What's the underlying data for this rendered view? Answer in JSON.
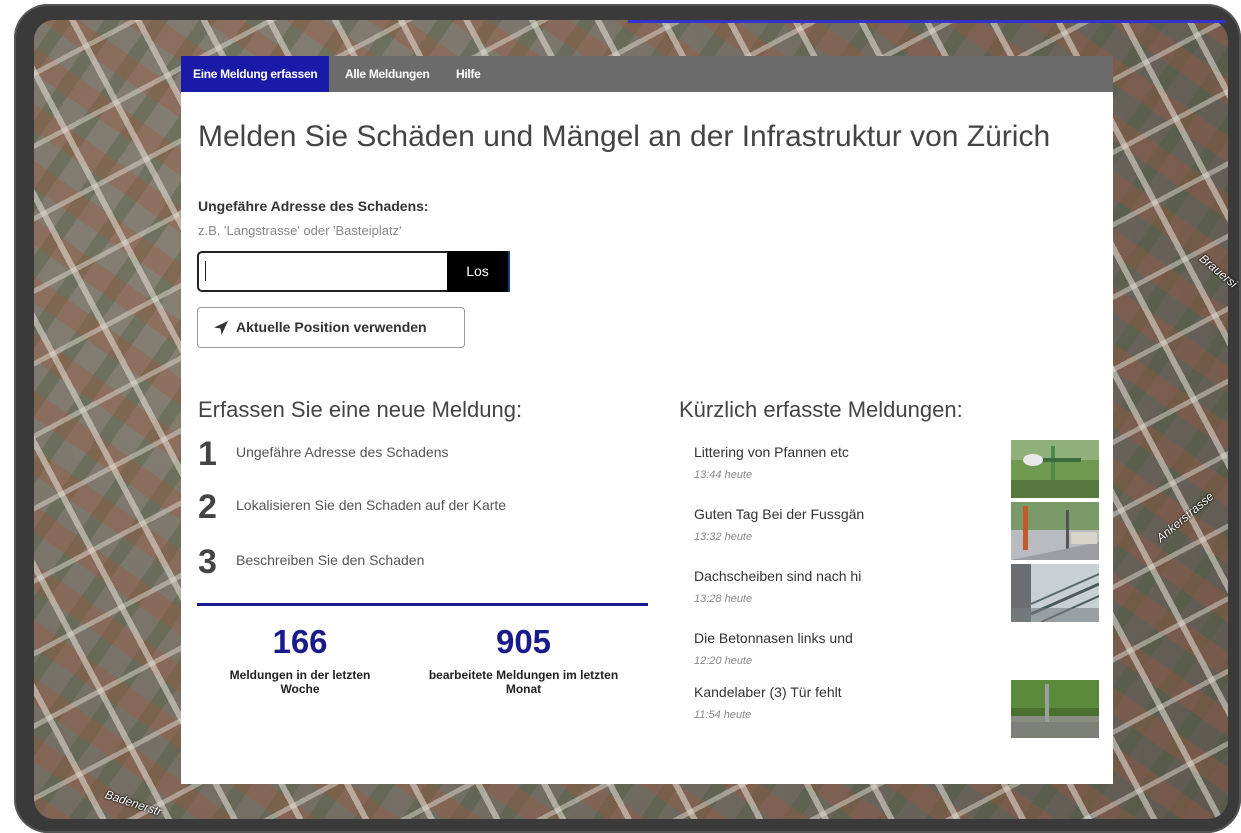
{
  "nav": {
    "items": [
      {
        "label": "Eine Meldung erfassen"
      },
      {
        "label": "Alle Meldungen"
      },
      {
        "label": "Hilfe"
      }
    ]
  },
  "map_labels": [
    "Brauersi",
    "Ankerstrasse",
    "Badenerstr"
  ],
  "headline": "Melden Sie Schäden und Mängel an der Infrastruktur von Zürich",
  "address": {
    "label": "Ungefähre Adresse des Schadens:",
    "hint": "z.B. 'Langstrasse' oder 'Basteiplatz'",
    "value": "",
    "go_label": "Los",
    "position_label": "Aktuelle Position verwenden"
  },
  "steps_title": "Erfassen Sie eine neue Meldung:",
  "steps": [
    {
      "num": "1",
      "text": "Ungefähre Adresse des Schadens"
    },
    {
      "num": "2",
      "text": "Lokalisieren Sie den Schaden auf der Karte"
    },
    {
      "num": "3",
      "text": "Beschreiben Sie den Schaden"
    }
  ],
  "stats": [
    {
      "value": "166",
      "label": "Meldungen in der letzten Woche"
    },
    {
      "value": "905",
      "label": "bearbeitete Meldungen im letzten Monat"
    }
  ],
  "recent_title": "Kürzlich erfasste Meldungen:",
  "recent": [
    {
      "title": "Littering von Pfannen etc",
      "time": "13:44 heute",
      "thumb": "bench-grass-photo"
    },
    {
      "title": "Guten Tag Bei der Fussgän",
      "time": "13:32 heute",
      "thumb": "sidewalk-pole-photo"
    },
    {
      "title": "Dachscheiben sind nach hi",
      "time": "13:28 heute",
      "thumb": "glass-roof-photo"
    },
    {
      "title": "Die Betonnasen links und",
      "time": "12:20 heute",
      "thumb": ""
    },
    {
      "title": "Kandelaber (3) Tür fehlt",
      "time": "11:54 heute",
      "thumb": "hedge-lamppost-photo"
    }
  ],
  "colors": {
    "nav_active": "#1a1aa8",
    "stat_blue": "#1a1a8c",
    "nav_bg": "#6b6b6b"
  }
}
